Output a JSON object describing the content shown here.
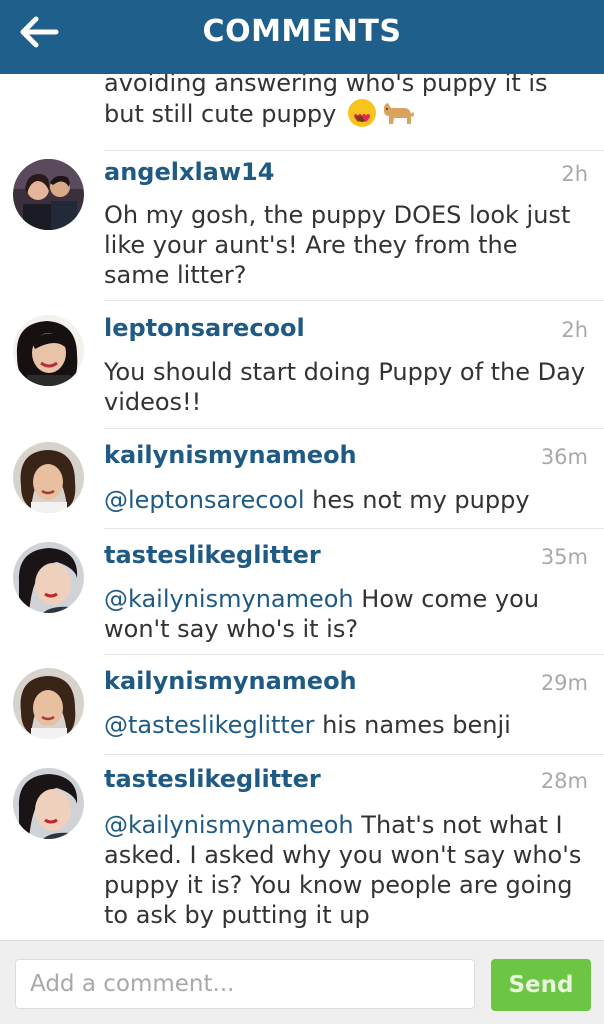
{
  "header": {
    "title": "COMMENTS",
    "back_icon": "arrow-left-icon"
  },
  "partial_comment": {
    "line1": "avoiding answering who's puppy it is",
    "line2": "but still cute puppy",
    "emojis": [
      "heart-eyes-emoji-icon",
      "dog-emoji-icon"
    ]
  },
  "comments": [
    {
      "username": "angelxlaw14",
      "time": "2h",
      "mention": "",
      "text": "Oh my gosh, the puppy DOES look just like your aunt's! Are they from the same litter?"
    },
    {
      "username": "leptonsarecool",
      "time": "2h",
      "mention": "",
      "text": "You should start doing Puppy of the Day videos!!"
    },
    {
      "username": "kailynismynameoh",
      "time": "36m",
      "mention": "@leptonsarecool",
      "text": " hes not my puppy"
    },
    {
      "username": "tasteslikeglitter",
      "time": "35m",
      "mention": "@kailynismynameoh",
      "text": " How come you won't say who's it is?"
    },
    {
      "username": "kailynismynameoh",
      "time": "29m",
      "mention": "@tasteslikeglitter",
      "text": " his names benji"
    },
    {
      "username": "tasteslikeglitter",
      "time": "28m",
      "mention": "@kailynismynameoh",
      "text": " That's not what I asked. I asked why you won't say who's puppy it is? You know people are going to ask by putting it up"
    }
  ],
  "input": {
    "placeholder": "Add a comment...",
    "send_label": "Send"
  },
  "colors": {
    "header_bg": "#1f5f8c",
    "username": "#1f5a85",
    "send_button": "#6cc644"
  }
}
